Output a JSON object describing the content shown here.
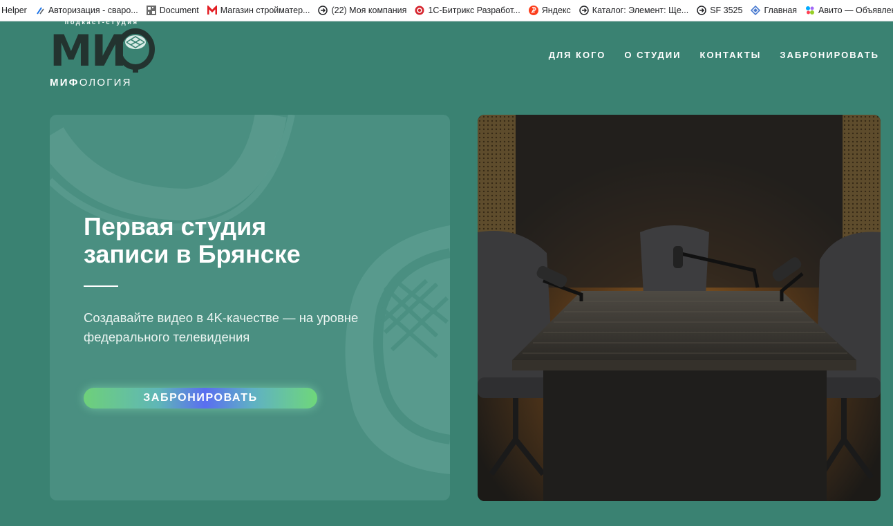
{
  "bookmarks": [
    {
      "label": "Helper",
      "icon": "none"
    },
    {
      "label": "Авторизация - сваро...",
      "icon": "tools-icon"
    },
    {
      "label": "Document",
      "icon": "qr-icon"
    },
    {
      "label": "Магазин стройматер...",
      "icon": "m-logo-icon"
    },
    {
      "label": "(22) Моя компания",
      "icon": "arrow-circle-icon"
    },
    {
      "label": "1С-Битрикс Разработ...",
      "icon": "bitrix-icon"
    },
    {
      "label": "Яндекс",
      "icon": "yandex-icon"
    },
    {
      "label": "Каталог: Элемент: Ще...",
      "icon": "arrow-circle-icon"
    },
    {
      "label": "SF 3525",
      "icon": "arrow-circle-icon"
    },
    {
      "label": "Главная",
      "icon": "diamond-icon"
    },
    {
      "label": "Авито — Объявлени...",
      "icon": "avito-icon"
    }
  ],
  "logo": {
    "tagline": "подкаст-студия",
    "mark": "МИ",
    "name_bold": "МИФ",
    "name_rest": "ОЛОГИЯ"
  },
  "nav": {
    "items": [
      "ДЛЯ КОГО",
      "О СТУДИИ",
      "КОНТАКТЫ",
      "ЗАБРОНИРОВАТЬ"
    ]
  },
  "hero": {
    "title_line1": "Первая студия",
    "title_line2": "записи в Брянске",
    "subtitle": "Создавайте видео в 4K-качестве — на уровне федерального телевидения",
    "button_label": "ЗАБРОНИРОВАТЬ"
  },
  "colors": {
    "page_bg": "#3a8272",
    "card_bg": "#4a8f81",
    "logo_dark": "#23332f"
  }
}
